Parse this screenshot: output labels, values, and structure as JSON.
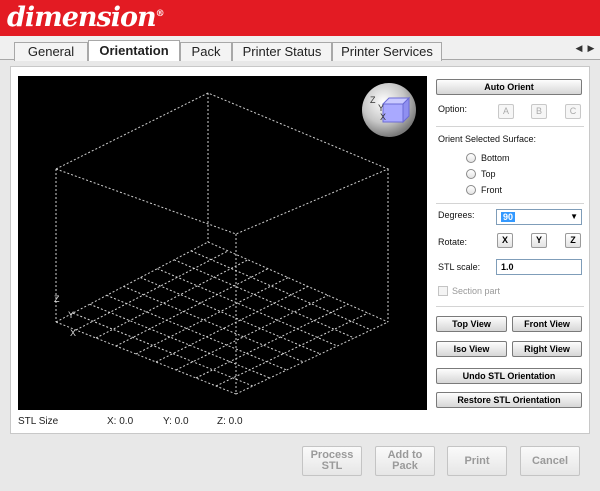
{
  "app": {
    "logo_text": "dimension",
    "logo_mark": "®"
  },
  "tabs": [
    {
      "label": "General"
    },
    {
      "label": "Orientation",
      "active": true
    },
    {
      "label": "Pack"
    },
    {
      "label": "Printer Status"
    },
    {
      "label": "Printer Services"
    }
  ],
  "tab_scroll": {
    "left": "◀",
    "right": "▶"
  },
  "viewport": {
    "axis_z": "Z",
    "axis_y": "Y",
    "axis_x": "X"
  },
  "nav_cube": {
    "z": "Z",
    "y": "Y",
    "x": "X"
  },
  "stl_size": {
    "label": "STL Size",
    "x": "X:  0.0",
    "y": "Y:  0.0",
    "z": "Z:  0.0"
  },
  "panel": {
    "auto_orient": "Auto Orient",
    "option_label": "Option:",
    "options": [
      "A",
      "B",
      "C"
    ],
    "orient_surface_label": "Orient Selected Surface:",
    "surfaces": [
      "Bottom",
      "Top",
      "Front"
    ],
    "degrees_label": "Degrees:",
    "degrees_value": "90",
    "rotate_label": "Rotate:",
    "rotate_axes": [
      "X",
      "Y",
      "Z"
    ],
    "stl_scale_label": "STL scale:",
    "stl_scale_value": "1.0",
    "section_part": "Section part",
    "top_view": "Top View",
    "front_view": "Front View",
    "iso_view": "Iso View",
    "right_view": "Right View",
    "undo": "Undo STL Orientation",
    "restore": "Restore STL Orientation"
  },
  "footer": {
    "process_1": "Process",
    "process_2": "STL",
    "add_1": "Add to",
    "add_2": "Pack",
    "print": "Print",
    "cancel": "Cancel"
  },
  "colors": {
    "brand_red": "#e31b23",
    "selection_blue": "#3399ff"
  }
}
